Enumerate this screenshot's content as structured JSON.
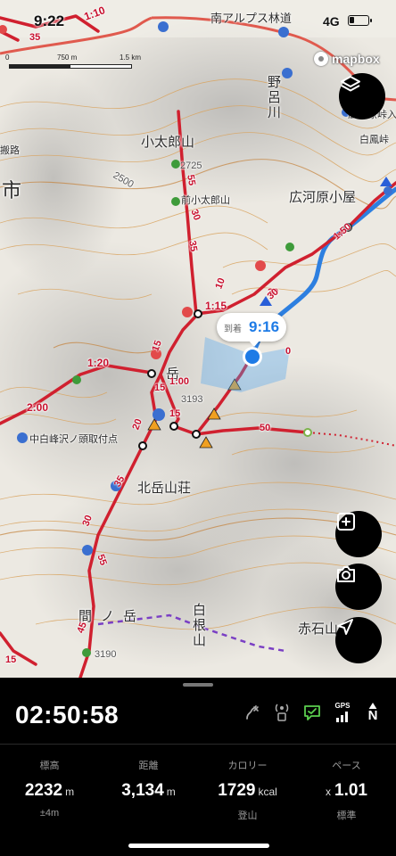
{
  "status_bar": {
    "time": "9:22",
    "network": "4G",
    "battery_level": 0.25
  },
  "scale": {
    "ticks": [
      "0",
      "750 m",
      "1.5 km"
    ]
  },
  "attribution": {
    "brand": "mapbox"
  },
  "map": {
    "place_labels": [
      {
        "id": "rindo",
        "text": "南アルプス林道"
      },
      {
        "id": "hirokawara-pass",
        "text": "広河原峠入"
      },
      {
        "id": "hakuho-pass",
        "text": "白鳳峠"
      },
      {
        "id": "noro-river",
        "text": "野呂川"
      },
      {
        "id": "kotaro-yama",
        "text": "小太郎山"
      },
      {
        "id": "elev-2725",
        "text": "2725"
      },
      {
        "id": "maekotaro",
        "text": "前小太郎山"
      },
      {
        "id": "hirokawara-hut",
        "text": "広河原小屋"
      },
      {
        "id": "city",
        "text": "市"
      },
      {
        "id": "kanpan-road",
        "text": "搬路"
      },
      {
        "id": "dake",
        "text": "岳"
      },
      {
        "id": "elev-3193",
        "text": "3193"
      },
      {
        "id": "nakashirane",
        "text": "中白峰沢ノ頭取付点"
      },
      {
        "id": "kitadake-sanso",
        "text": "北岳山荘"
      },
      {
        "id": "aino-dake",
        "text": "間ノ岳"
      },
      {
        "id": "shirane",
        "text": "白根山"
      },
      {
        "id": "akaishi",
        "text": "赤石山"
      },
      {
        "id": "elev-3190",
        "text": "3190"
      },
      {
        "id": "elev-2500",
        "text": "2500"
      }
    ],
    "course_times": [
      "1:10",
      "35",
      "1:15",
      "10",
      "30",
      "1:20",
      "15",
      "15",
      "2:00",
      "20",
      "30",
      "35",
      "35",
      "55",
      "15",
      "1:00",
      "50",
      "1:50",
      "30",
      "55",
      "30",
      "45",
      "15",
      "0"
    ]
  },
  "arrival": {
    "label": "到着",
    "time": "9:16"
  },
  "buttons": {
    "layers": "layers-icon",
    "add_memo": "add-note-icon",
    "camera": "camera-icon",
    "locate": "location-arrow-icon"
  },
  "panel": {
    "elapsed": "02:50:58",
    "status_icons": [
      "route-icon",
      "signal-tower-icon",
      "messaging-icon",
      "gps-icon",
      "compass-north-icon"
    ],
    "gps_label": "GPS",
    "compass_label": "N",
    "stats": [
      {
        "title": "標高",
        "value": "2232",
        "unit": "m",
        "prefix": "",
        "sub": "±4m"
      },
      {
        "title": "距離",
        "value": "3,134",
        "unit": "m",
        "prefix": "",
        "sub": ""
      },
      {
        "title": "カロリー",
        "value": "1729",
        "unit": "kcal",
        "prefix": "",
        "sub": "登山"
      },
      {
        "title": "ペース",
        "value": "1.01",
        "unit": "",
        "prefix": "x",
        "sub": "標準"
      }
    ]
  },
  "colors": {
    "route": "#d0202f",
    "track": "#2d7fe0",
    "accent": "#1e7be6",
    "contour": "#d9a460"
  }
}
